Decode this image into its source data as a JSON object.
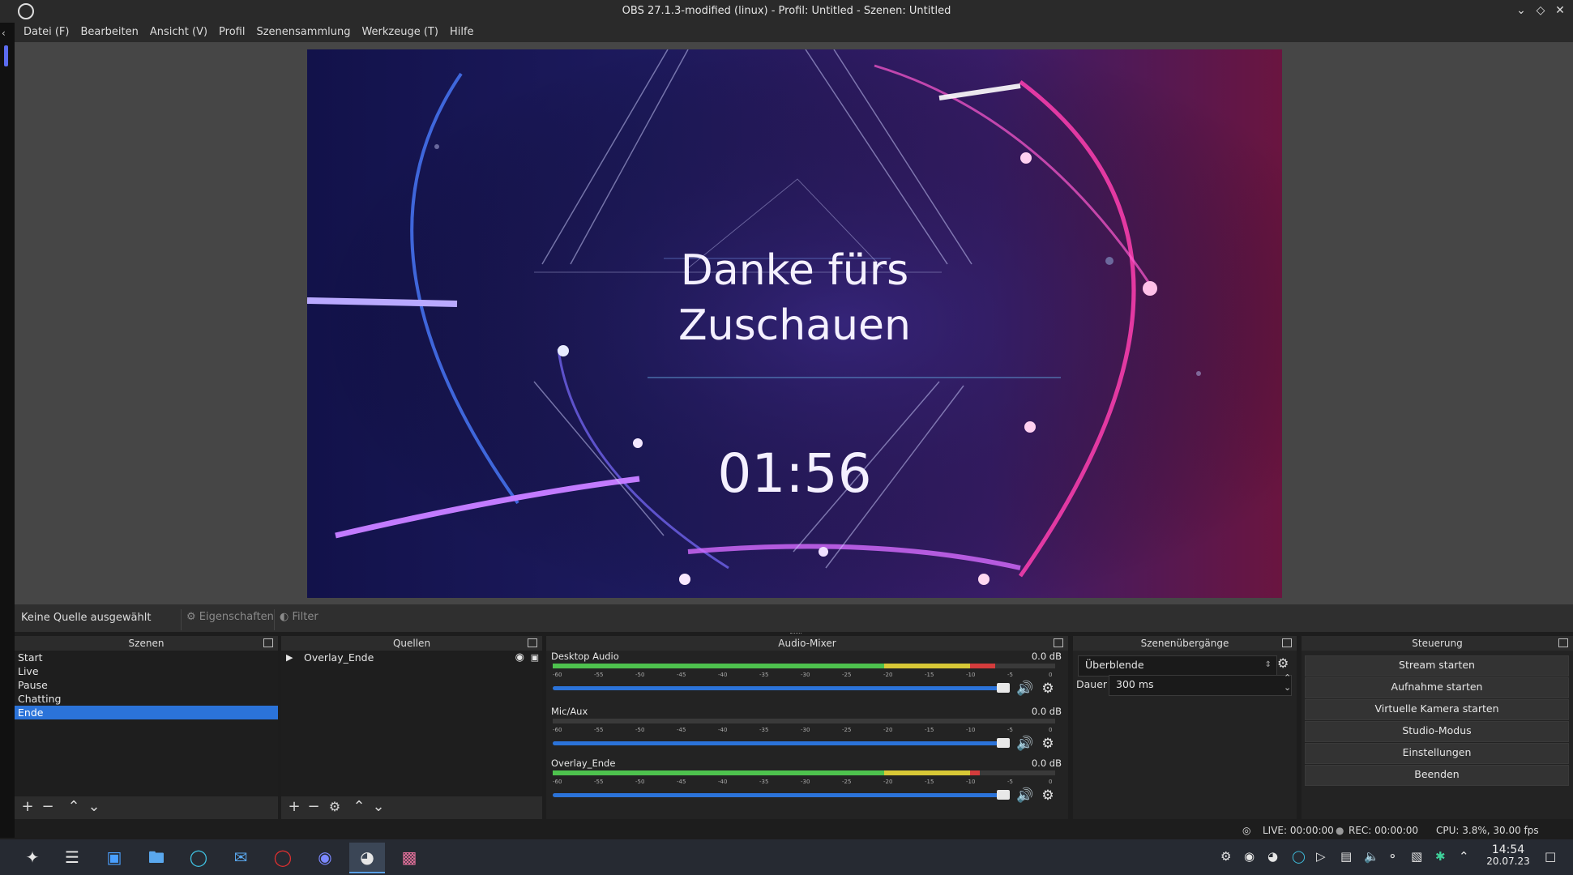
{
  "window": {
    "title": "OBS 27.1.3-modified (linux) - Profil: Untitled - Szenen: Untitled"
  },
  "menu": [
    "Datei (F)",
    "Bearbeiten",
    "Ansicht (V)",
    "Profil",
    "Szenensammlung",
    "Werkzeuge (T)",
    "Hilfe"
  ],
  "preview": {
    "line1": "Danke fürs",
    "line2": "Zuschauen",
    "timer": "01:56"
  },
  "source_toolbar": {
    "no_source": "Keine Quelle ausgewählt",
    "properties": "Eigenschaften",
    "filter": "Filter"
  },
  "scenes": {
    "title": "Szenen",
    "items": [
      "Start",
      "Live",
      "Pause",
      "Chatting",
      "Ende"
    ],
    "selected": "Ende"
  },
  "sources": {
    "title": "Quellen",
    "items": [
      "Overlay_Ende"
    ]
  },
  "mixer": {
    "title": "Audio-Mixer",
    "scale": [
      "-60",
      "-55",
      "-50",
      "-45",
      "-40",
      "-35",
      "-30",
      "-25",
      "-20",
      "-15",
      "-10",
      "-5",
      "0"
    ],
    "channels": [
      {
        "name": "Desktop Audio",
        "db": "0.0 dB",
        "level": 0.88,
        "volume": 1.0
      },
      {
        "name": "Mic/Aux",
        "db": "0.0 dB",
        "level": 0.0,
        "volume": 1.0
      },
      {
        "name": "Overlay_Ende",
        "db": "0.0 dB",
        "level": 0.85,
        "volume": 1.0
      }
    ]
  },
  "transitions": {
    "title": "Szenenübergänge",
    "selected": "Überblende",
    "duration_label": "Dauer",
    "duration_value": "300 ms"
  },
  "controls": {
    "title": "Steuerung",
    "buttons": [
      "Stream starten",
      "Aufnahme starten",
      "Virtuelle Kamera starten",
      "Studio-Modus",
      "Einstellungen",
      "Beenden"
    ]
  },
  "status": {
    "live": "LIVE: 00:00:00",
    "rec": "REC: 00:00:00",
    "cpu": "CPU: 3.8%, 30.00 fps"
  },
  "taskbar": {
    "time": "14:54",
    "date": "20.07.23"
  },
  "colors": {
    "accent": "#2b73d9",
    "meter_green": "#4ec24e",
    "meter_yellow": "#d8c836",
    "meter_red": "#d43c3c"
  }
}
